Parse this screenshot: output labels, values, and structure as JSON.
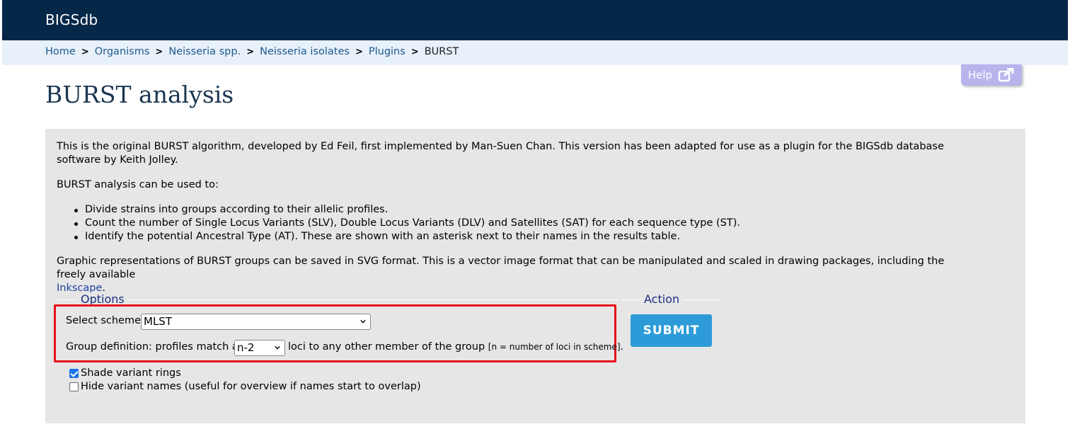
{
  "header": {
    "app_title": "BIGSdb"
  },
  "breadcrumb": {
    "items": [
      "Home",
      "Organisms",
      "Neisseria spp.",
      "Neisseria isolates",
      "Plugins"
    ],
    "separator": ">",
    "current": "BURST"
  },
  "help": {
    "label": "Help",
    "icon": "external-link-icon"
  },
  "page": {
    "title": "BURST analysis"
  },
  "description": {
    "intro": "This is the original BURST algorithm, developed by Ed Feil, first implemented by Man-Suen Chan. This version has been adapted for use as a plugin for the BIGSdb database software by Keith Jolley.",
    "uses_heading": "BURST analysis can be used to:",
    "uses": [
      "Divide strains into groups according to their allelic profiles.",
      "Count the number of Single Locus Variants (SLV), Double Locus Variants (DLV) and Satellites (SAT) for each sequence type (ST).",
      "Identify the potential Ancestral Type (AT). These are shown with an asterisk next to their names in the results table."
    ],
    "graphic_text": "Graphic representations of BURST groups can be saved in SVG format. This is a vector image format that can be manipulated and scaled in drawing packages, including the freely available",
    "graphic_link": "Inkscape",
    "graphic_end": "."
  },
  "options": {
    "legend": "Options",
    "scheme_label": "Select scheme:",
    "scheme_value": "MLST",
    "group_label": "Group definition: profiles match at",
    "group_value": "n-2",
    "group_label_after": "loci to any other member of the group",
    "group_note": "[n = number of loci in scheme]",
    "group_end": ".",
    "shade_label": "Shade variant rings",
    "shade_checked": true,
    "hide_label": "Hide variant names (useful for overview if names start to overlap)",
    "hide_checked": false
  },
  "action": {
    "legend": "Action",
    "submit_label": "SUBMIT"
  },
  "colors": {
    "header_bg": "#052849",
    "submit_bg": "#2d9bd8",
    "highlight": "#e8101a",
    "help_bg": "#b8b4ec"
  }
}
